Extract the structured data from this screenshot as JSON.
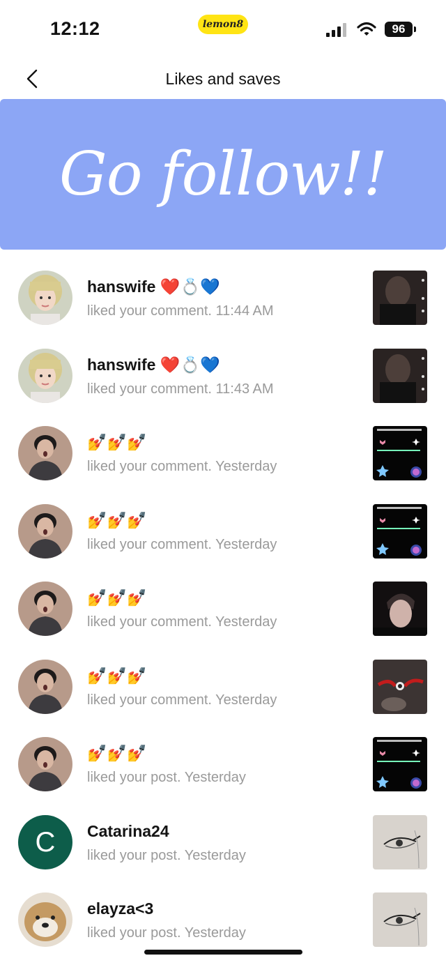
{
  "status": {
    "time": "12:12",
    "app_badge": "lemon8",
    "battery": "96"
  },
  "header": {
    "title": "Likes and saves"
  },
  "banner": {
    "text": "Go follow!!",
    "bg_color": "#8ca6f5"
  },
  "notifications": [
    {
      "name": "hanswife ❤️💍💙",
      "action": "liked your comment.",
      "time": "11:44 AM",
      "avatar": "photo-blonde",
      "thumb": "video-dark"
    },
    {
      "name": "hanswife ❤️💍💙",
      "action": "liked your comment.",
      "time": "11:43 AM",
      "avatar": "photo-blonde",
      "thumb": "video-dark"
    },
    {
      "name": "💅💅💅",
      "action": "liked your comment.",
      "time": "Yesterday",
      "avatar": "photo-boy",
      "thumb": "video-black-stickers"
    },
    {
      "name": "💅💅💅",
      "action": "liked your comment.",
      "time": "Yesterday",
      "avatar": "photo-boy",
      "thumb": "video-black-stickers"
    },
    {
      "name": "💅💅💅",
      "action": "liked your comment.",
      "time": "Yesterday",
      "avatar": "photo-boy",
      "thumb": "video-face"
    },
    {
      "name": "💅💅💅",
      "action": "liked your comment.",
      "time": "Yesterday",
      "avatar": "photo-boy",
      "thumb": "video-red-eyes"
    },
    {
      "name": "💅💅💅",
      "action": "liked your post.",
      "time": "Yesterday",
      "avatar": "photo-boy",
      "thumb": "video-black-stickers"
    },
    {
      "name": "Catarina24",
      "action": "liked your post.",
      "time": "Yesterday",
      "avatar": "letter-C",
      "avatar_letter": "C",
      "thumb": "sketch-eye"
    },
    {
      "name": "elayza<3",
      "action": "liked your post.",
      "time": "Yesterday",
      "avatar": "photo-dog",
      "thumb": "sketch-eye"
    }
  ]
}
